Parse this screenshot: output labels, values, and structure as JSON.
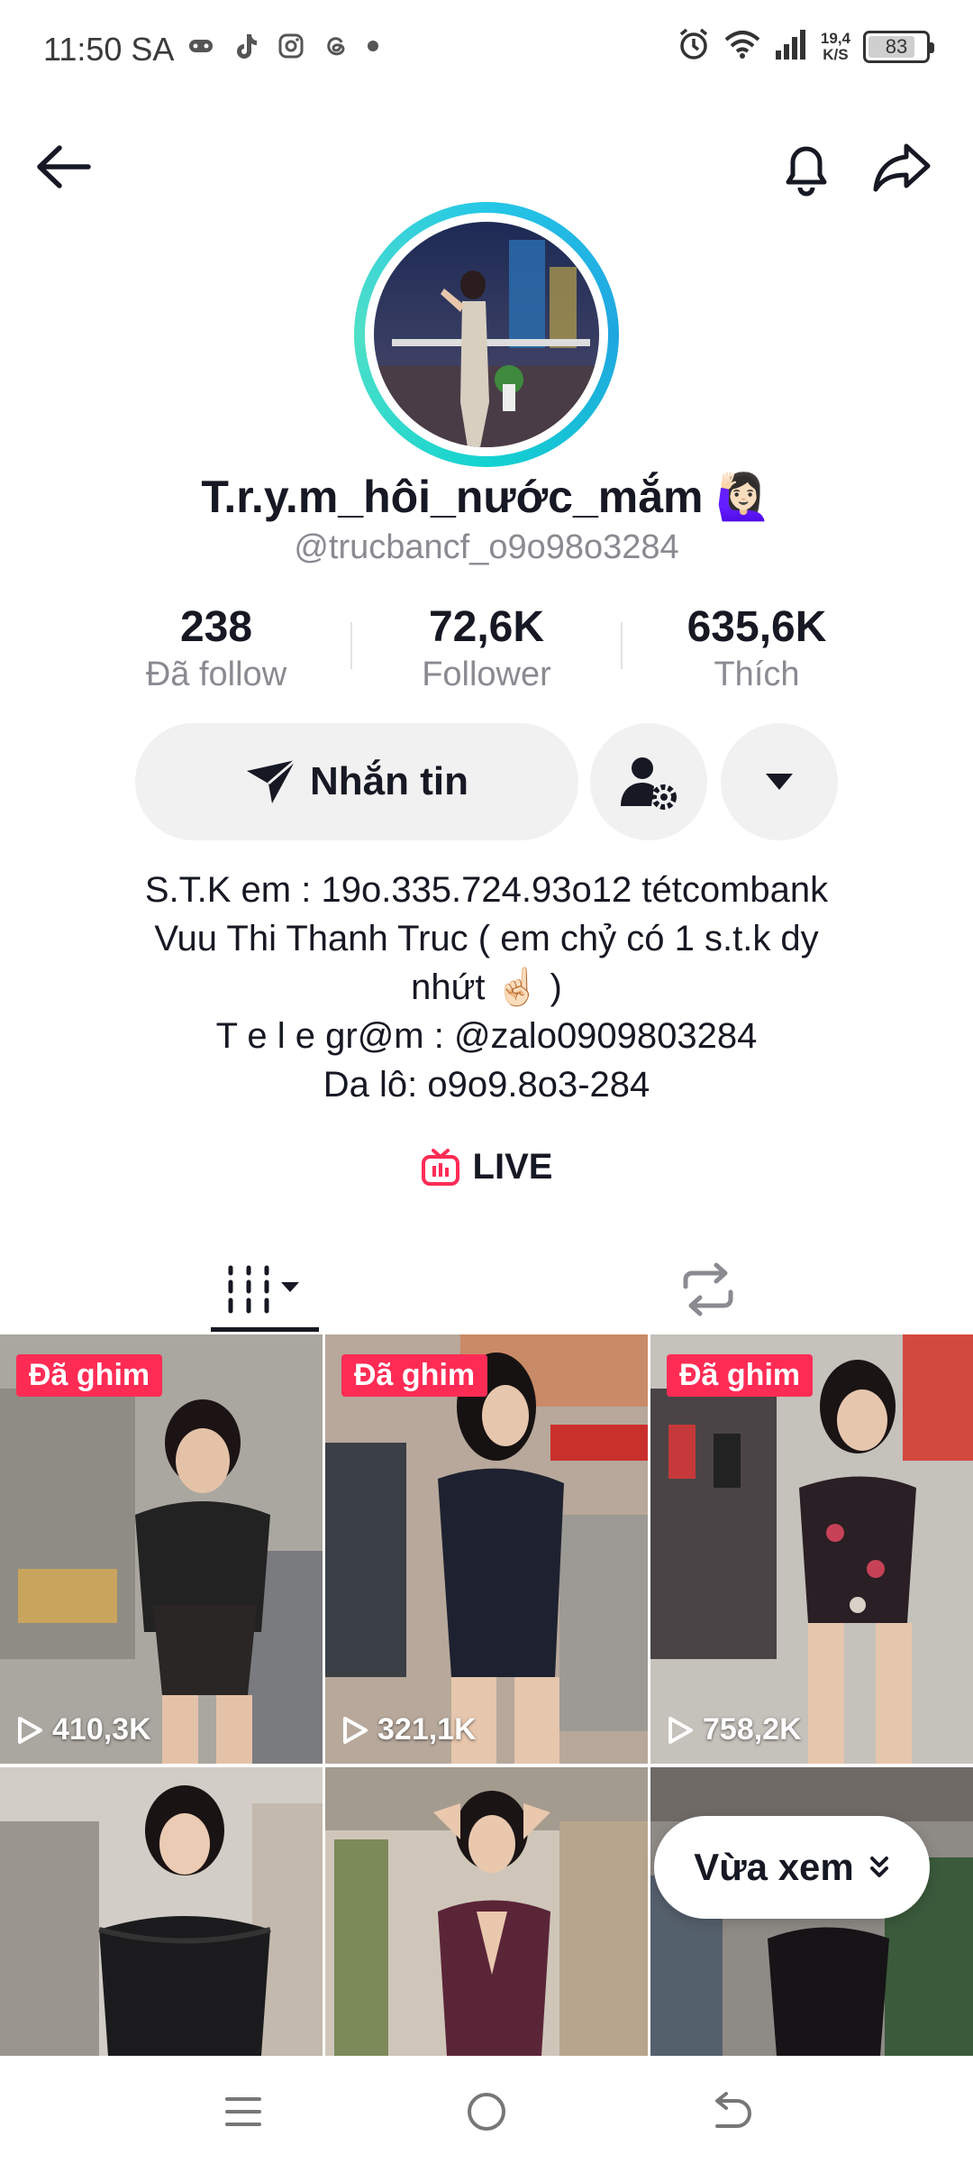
{
  "status_bar": {
    "time": "11:50 SA",
    "net_speed_value": "19,4",
    "net_speed_unit": "K/S",
    "battery": "83",
    "battery_level_percent": 83
  },
  "profile": {
    "display_name": "T.r.y.m_hôi_nước_mắm 🙋🏻‍♀️",
    "username": "@trucbancf_o9o98o3284",
    "stats": [
      {
        "value": "238",
        "label": "Đã follow"
      },
      {
        "value": "72,6K",
        "label": "Follower"
      },
      {
        "value": "635,6K",
        "label": "Thích"
      }
    ],
    "message_label": "Nhắn tin",
    "bio_lines": [
      "S.T.K em : 19o.335.724.93o12 tétcombank",
      "Vuu Thi Thanh Truc ( em chỷ có 1 s.t.k dy",
      "nhứt ☝🏻 )",
      "T e l e gr@m : @zalo0909803284",
      "Da lô: o9o9.8o3-284"
    ],
    "live_label": "LIVE"
  },
  "videos": [
    {
      "pinned_label": "Đã ghim",
      "views": "410,3K"
    },
    {
      "pinned_label": "Đã ghim",
      "views": "321,1K"
    },
    {
      "pinned_label": "Đã ghim",
      "views": "758,2K"
    },
    {
      "pinned_label": "",
      "views": ""
    },
    {
      "pinned_label": "",
      "views": ""
    },
    {
      "pinned_label": "",
      "views": ""
    }
  ],
  "recent_button_label": "Vừa xem",
  "colors": {
    "accent": "#fe2c55",
    "ring": "#25c7e6",
    "button_bg": "#f1f1f2",
    "secondary_text": "#8a8b91"
  },
  "icons": [
    "back-arrow-icon",
    "bell-icon",
    "share-icon",
    "send-icon",
    "user-settings-icon",
    "triangle-down-icon",
    "live-tv-icon",
    "grid-view-icon",
    "repost-icon",
    "play-icon",
    "chevron-double-down-icon",
    "menu-icon",
    "home-circle-icon",
    "return-icon"
  ]
}
